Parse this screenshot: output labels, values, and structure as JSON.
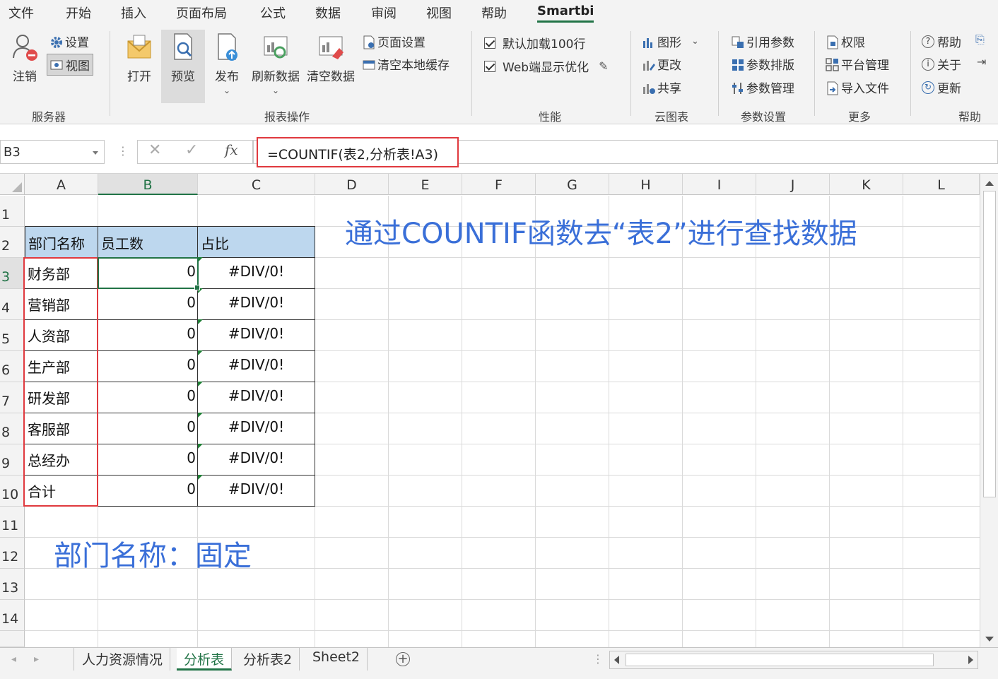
{
  "menu": {
    "tabs": [
      "文件",
      "开始",
      "插入",
      "页面布局",
      "公式",
      "数据",
      "审阅",
      "视图",
      "帮助",
      "Smartbi"
    ],
    "active": "Smartbi"
  },
  "ribbon": {
    "server": {
      "logout": "注销",
      "settings": "设置",
      "view": "视图",
      "label": "服务器"
    },
    "report": {
      "open": "打开",
      "preview": "预览",
      "publish": "发布",
      "refresh": "刷新数据",
      "clear": "清空数据",
      "page_setup": "页面设置",
      "clear_cache": "清空本地缓存",
      "label": "报表操作"
    },
    "performance": {
      "load100": "默认加载100行",
      "web_opt": "Web端显示优化",
      "label": "性能"
    },
    "cloud": {
      "chart": "图形",
      "edit": "更改",
      "share": "共享",
      "label": "云图表"
    },
    "params": {
      "ref": "引用参数",
      "layout": "参数排版",
      "manage": "参数管理",
      "label": "参数设置"
    },
    "more": {
      "perm": "权限",
      "platform": "平台管理",
      "import": "导入文件",
      "label": "更多"
    },
    "help": {
      "help": "帮助",
      "about": "关于",
      "update": "更新",
      "label": "帮助"
    }
  },
  "formula_bar": {
    "name_box": "B3",
    "cancel": "✕",
    "confirm": "✓",
    "fx": "fx",
    "formula": "=COUNTIF(表2,分析表!A3)"
  },
  "sheet": {
    "columns": [
      "A",
      "B",
      "C",
      "D",
      "E",
      "F",
      "G",
      "H",
      "I",
      "J",
      "K",
      "L"
    ],
    "rows": [
      "1",
      "2",
      "3",
      "4",
      "5",
      "6",
      "7",
      "8",
      "9",
      "10",
      "11",
      "12",
      "13",
      "14"
    ],
    "header": [
      "部门名称",
      "员工数",
      "占比"
    ],
    "data": [
      {
        "dept": "财务部",
        "count": "0",
        "pct": "#DIV/0!"
      },
      {
        "dept": "营销部",
        "count": "0",
        "pct": "#DIV/0!"
      },
      {
        "dept": "人资部",
        "count": "0",
        "pct": "#DIV/0!"
      },
      {
        "dept": "生产部",
        "count": "0",
        "pct": "#DIV/0!"
      },
      {
        "dept": "研发部",
        "count": "0",
        "pct": "#DIV/0!"
      },
      {
        "dept": "客服部",
        "count": "0",
        "pct": "#DIV/0!"
      },
      {
        "dept": "总经办",
        "count": "0",
        "pct": "#DIV/0!"
      },
      {
        "dept": "合计",
        "count": "0",
        "pct": "#DIV/0!"
      }
    ],
    "annotation_top": "通过COUNTIF函数去“表2”进行查找数据",
    "annotation_bottom": "部门名称：固定"
  },
  "sheet_tabs": [
    "人力资源情况",
    "分析表",
    "分析表2",
    "Sheet2"
  ],
  "active_sheet": "分析表",
  "colors": {
    "accent": "#217346",
    "header_fill": "#bdd7ee",
    "highlight": "#e0393e",
    "annotation": "#3a6fd8"
  }
}
